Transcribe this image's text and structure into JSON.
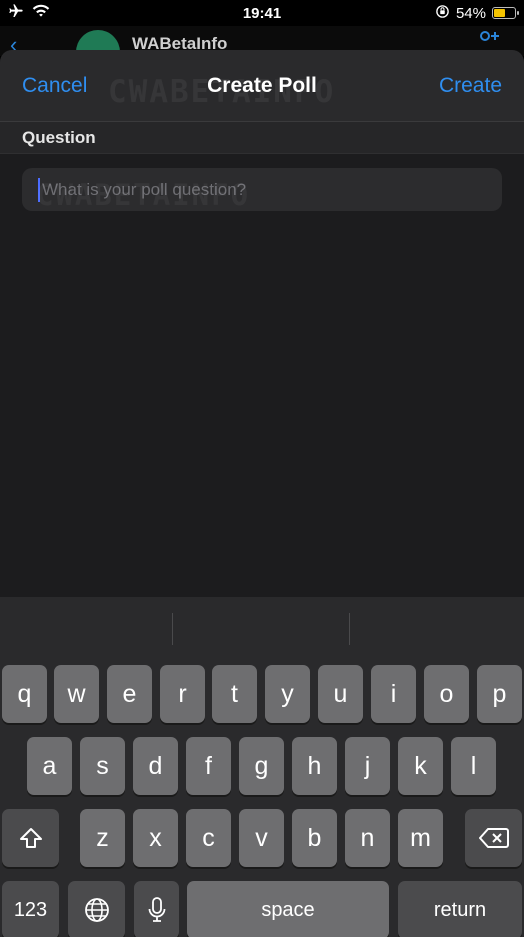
{
  "status_bar": {
    "time": "19:41",
    "battery_percent": "54%",
    "battery_level": 0.54,
    "icons": [
      "airplane-icon",
      "wifi-icon",
      "orientation-lock-icon",
      "battery-icon"
    ]
  },
  "background_chat": {
    "title": "WABetaInfo"
  },
  "nav": {
    "cancel_label": "Cancel",
    "title": "Create Poll",
    "create_label": "Create"
  },
  "question": {
    "section_label": "Question",
    "placeholder": "What is your poll question?",
    "value": ""
  },
  "watermark": "CWABETAINFO",
  "keyboard": {
    "row1": [
      "q",
      "w",
      "e",
      "r",
      "t",
      "y",
      "u",
      "i",
      "o",
      "p"
    ],
    "row2": [
      "a",
      "s",
      "d",
      "f",
      "g",
      "h",
      "j",
      "k",
      "l"
    ],
    "row3": [
      "z",
      "x",
      "c",
      "v",
      "b",
      "n",
      "m"
    ],
    "numbers_label": "123",
    "space_label": "space",
    "return_label": "return"
  },
  "colors": {
    "accent": "#2f8ef0",
    "sheet_bg": "#1c1c1e",
    "key_bg": "#6e6e70",
    "battery": "#f5c400"
  }
}
